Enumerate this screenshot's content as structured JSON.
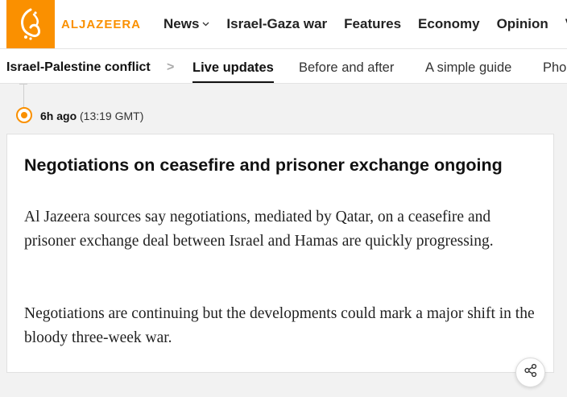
{
  "brand": {
    "name": "ALJAZEERA",
    "accent_color": "#fa9000",
    "logo_icon": "aljazeera-logo-icon"
  },
  "nav": {
    "items": [
      {
        "label": "News",
        "has_dropdown": true
      },
      {
        "label": "Israel-Gaza war"
      },
      {
        "label": "Features"
      },
      {
        "label": "Economy"
      },
      {
        "label": "Opinion"
      },
      {
        "label": "V"
      }
    ]
  },
  "subnav": {
    "topic": "Israel-Palestine conflict",
    "separator": ">",
    "tabs": [
      {
        "label": "Live updates",
        "active": true
      },
      {
        "label": "Before and after",
        "active": false
      },
      {
        "label": "A simple guide",
        "active": false
      },
      {
        "label": "Pho",
        "active": false
      }
    ]
  },
  "update": {
    "ago": "6h ago",
    "time": "(13:19 GMT)",
    "headline": "Negotiations on ceasefire and prisoner exchange ongoing",
    "paragraphs": [
      "Al Jazeera sources say negotiations, mediated by Qatar, on a ceasefire and prisoner exchange deal between Israel and Hamas are quickly progressing.",
      "Negotiations are continuing but the developments could mark a major shift in the bloody three-week war."
    ],
    "share_icon": "share-icon"
  }
}
